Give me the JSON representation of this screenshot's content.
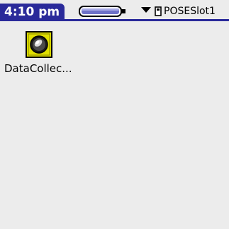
{
  "status_bar": {
    "time": "4:10 pm",
    "battery_icon": "battery-icon",
    "battery_level": 1.0,
    "category_dropdown": {
      "icon": "memory-card-icon",
      "label": "POSESlot1"
    }
  },
  "launcher": {
    "apps": [
      {
        "label": "DataCollec...",
        "icon": "data-collect-app-icon"
      }
    ]
  },
  "colors": {
    "tab_blue": "#2a2a9a",
    "background": "#ececec",
    "icon_yellow": "#e0df00"
  }
}
